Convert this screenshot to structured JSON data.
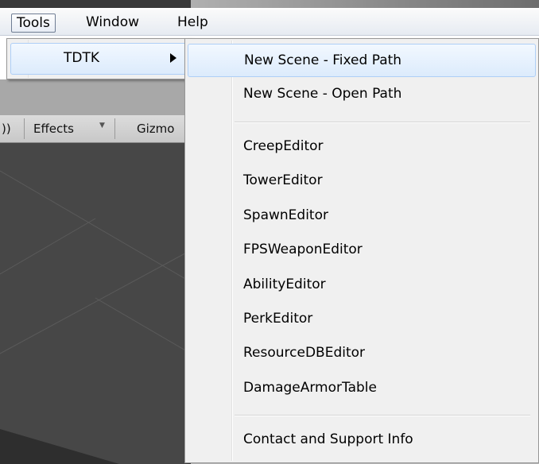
{
  "menubar": {
    "items": [
      {
        "label": "Tools",
        "open": true
      },
      {
        "label": "Window"
      },
      {
        "label": "Help"
      }
    ]
  },
  "tools_menu": {
    "items": [
      {
        "label": "TDTK",
        "has_submenu": true
      }
    ]
  },
  "tdtk_submenu": {
    "groups": [
      [
        {
          "label": "New Scene - Fixed Path",
          "highlighted": true
        },
        {
          "label": "New Scene - Open Path"
        }
      ],
      [
        {
          "label": "CreepEditor"
        },
        {
          "label": "TowerEditor"
        },
        {
          "label": "SpawnEditor"
        },
        {
          "label": "FPSWeaponEditor"
        },
        {
          "label": "AbilityEditor"
        },
        {
          "label": "PerkEditor"
        },
        {
          "label": "ResourceDBEditor"
        },
        {
          "label": "DamageArmorTable"
        }
      ],
      [
        {
          "label": "Contact and Support Info"
        }
      ]
    ]
  },
  "scene_toolbar": {
    "audio_glyph": "))",
    "effects_label": "Effects",
    "gizmos_label": "Gizmo"
  },
  "colors": {
    "menu_bg": "#f0f0f0",
    "highlight_border": "#aecff7",
    "scene_bg": "#474747"
  }
}
